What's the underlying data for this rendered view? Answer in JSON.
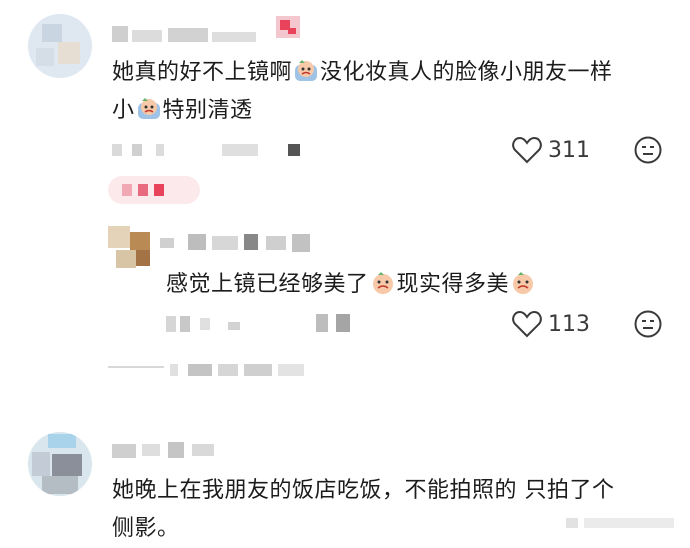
{
  "comments": [
    {
      "text_line1": "她真的好不上镜啊",
      "text_line1b": "没化妆真人的脸像小朋友一样",
      "text_line2a": "小",
      "text_line2b": "特别清透",
      "likes": "311"
    }
  ],
  "reply": {
    "text_a": "感觉上镜已经够美了",
    "text_b": "现实得多美",
    "likes": "113"
  },
  "comment2": {
    "line1": "她晚上在我朋友的饭店吃饭，不能拍照的 只拍了个",
    "line2": "侧影。"
  },
  "icons": {
    "heart": "heart-outline-icon",
    "dislike": "dislike-face-icon",
    "emoji": "crying-face-emoji"
  },
  "colors": {
    "text": "#1c1c1c",
    "icon": "#3a3a3a",
    "pink": "#e8435a"
  }
}
